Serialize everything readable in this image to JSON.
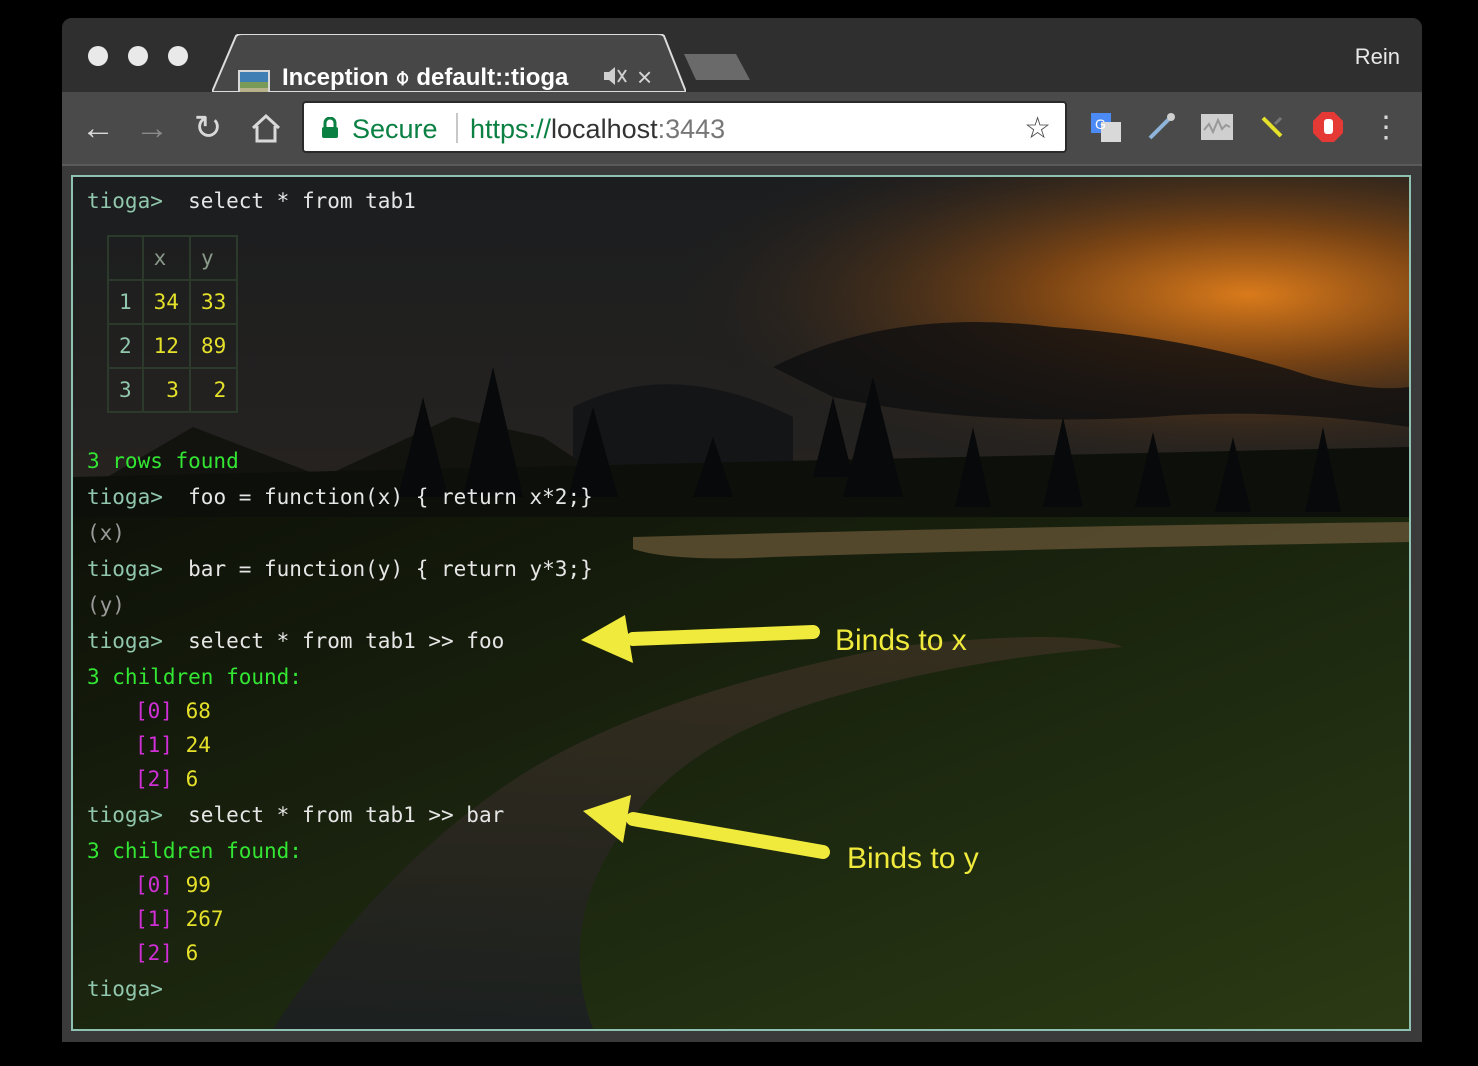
{
  "browser": {
    "tab_title": "Inception ⌽ default::tioga",
    "profile": "Rein",
    "secure_label": "Secure",
    "url_scheme": "https://",
    "url_host": "localhost",
    "url_port": ":3443",
    "extensions": [
      "google-translate-icon",
      "eyedropper-icon",
      "waveform-icon",
      "pin-icon",
      "adblock-icon"
    ],
    "colors": {
      "titlebar": "#2f2f2f",
      "toolbar": "#4a4a4a",
      "secure": "#0b8043"
    }
  },
  "terminal": {
    "prompt": "tioga>",
    "cmd1": "select * from tab1",
    "table": {
      "headers": [
        "",
        "x",
        "y"
      ],
      "rows": [
        [
          "1",
          "34",
          "33"
        ],
        [
          "2",
          "12",
          "89"
        ],
        [
          "3",
          "3",
          "2"
        ]
      ]
    },
    "rows_found": "3 rows found",
    "cmd2": "foo = function(x) { return x*2;}",
    "out2": "(x)",
    "cmd3": "bar = function(y) { return y*3;}",
    "out3": "(y)",
    "cmd4": "select * from tab1 >> foo",
    "found4": "3 children found:",
    "results4": [
      {
        "index": "[0]",
        "value": "68"
      },
      {
        "index": "[1]",
        "value": "24"
      },
      {
        "index": "[2]",
        "value": "6"
      }
    ],
    "cmd5": "select * from tab1 >> bar",
    "found5": "3 children found:",
    "results5": [
      {
        "index": "[0]",
        "value": "99"
      },
      {
        "index": "[1]",
        "value": "267"
      },
      {
        "index": "[2]",
        "value": "6"
      }
    ],
    "colors": {
      "prompt": "#90c7ad",
      "found": "#33e633",
      "index": "#d12fd6",
      "value": "#e5e02a"
    }
  },
  "annotations": {
    "binds_x": "Binds to x",
    "binds_y": "Binds to y",
    "color": "#f0ea3c"
  }
}
